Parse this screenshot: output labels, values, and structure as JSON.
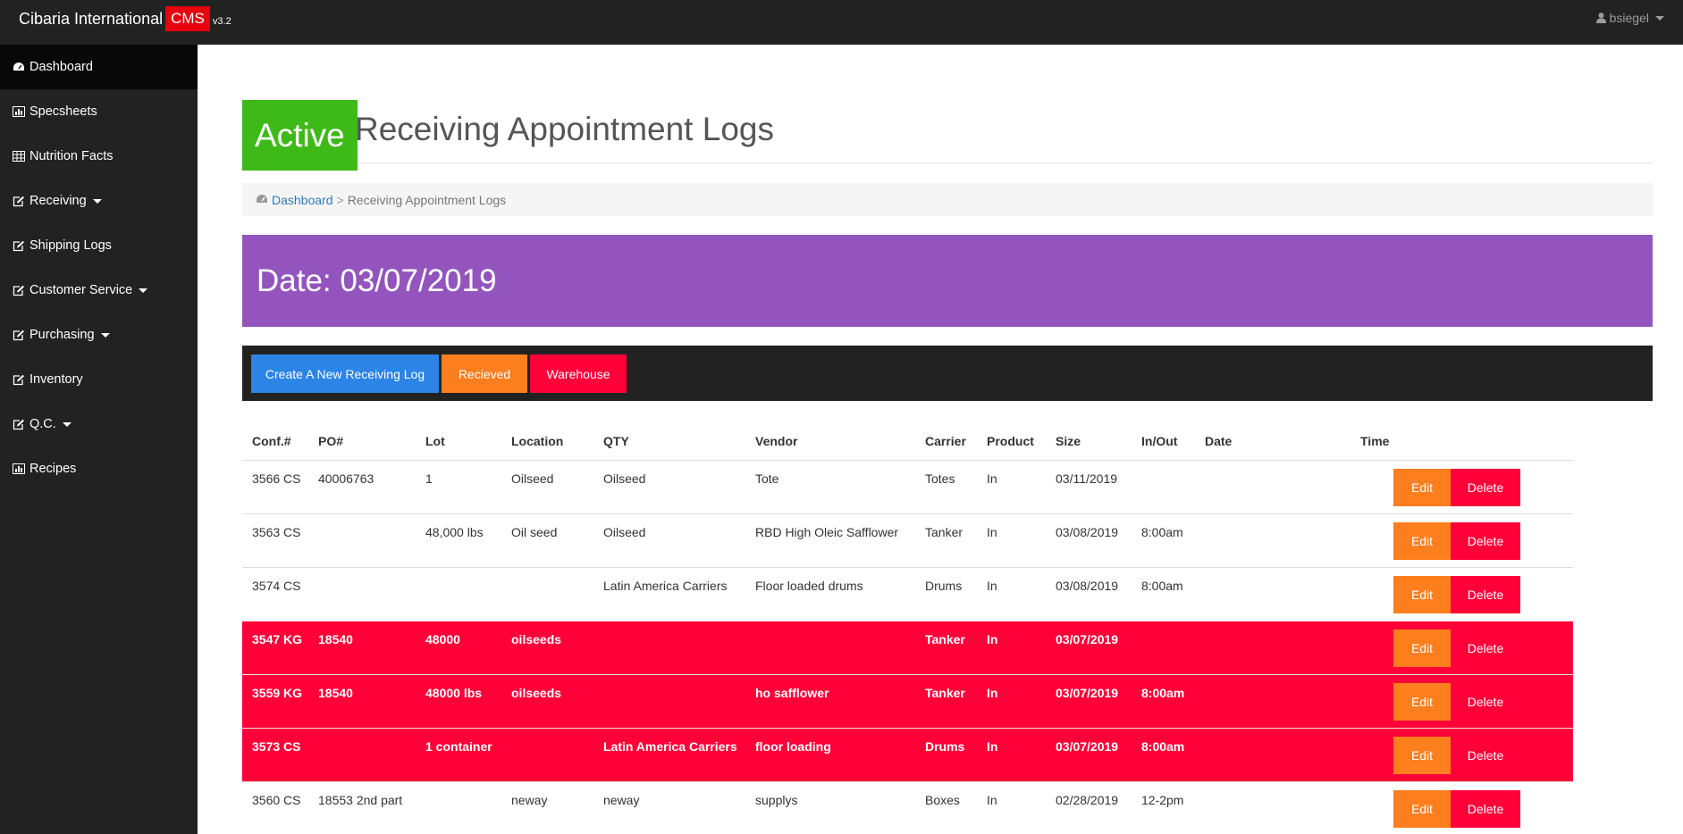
{
  "navbar": {
    "brand_name": "Cibaria International",
    "brand_badge": "CMS",
    "version": "v3.2",
    "username": "bsiegel"
  },
  "sidebar": {
    "items": [
      {
        "label": "Dashboard",
        "icon": "dashboard-icon",
        "dropdown": false
      },
      {
        "label": "Specsheets",
        "icon": "bar-chart-icon",
        "dropdown": false
      },
      {
        "label": "Nutrition Facts",
        "icon": "table-icon",
        "dropdown": false
      },
      {
        "label": "Receiving",
        "icon": "edit-icon",
        "dropdown": true
      },
      {
        "label": "Shipping Logs",
        "icon": "edit-icon",
        "dropdown": false
      },
      {
        "label": "Customer Service",
        "icon": "edit-icon",
        "dropdown": true
      },
      {
        "label": "Purchasing",
        "icon": "edit-icon",
        "dropdown": true
      },
      {
        "label": "Inventory",
        "icon": "edit-icon",
        "dropdown": false
      },
      {
        "label": "Q.C.",
        "icon": "edit-icon",
        "dropdown": true
      },
      {
        "label": "Recipes",
        "icon": "bar-chart-icon",
        "dropdown": false
      }
    ]
  },
  "heading": {
    "badge": "Active",
    "title": "Receiving Appointment Logs"
  },
  "breadcrumb": {
    "home": "Dashboard",
    "separator": ">",
    "current": "Receiving Appointment Logs"
  },
  "date_banner": "Date: 03/07/2019",
  "toolbar": {
    "create_label": "Create A New Receiving Log",
    "received_label": "Recieved",
    "warehouse_label": "Warehouse"
  },
  "table": {
    "headers": [
      "Conf.#",
      "PO#",
      "Lot",
      "Location",
      "QTY",
      "Vendor",
      "Carrier",
      "Product",
      "Size",
      "In/Out",
      "Date",
      "Time"
    ],
    "edit_label": "Edit",
    "delete_label": "Delete",
    "rows": [
      {
        "highlight": false,
        "cells": [
          "3566 CS",
          "40006763",
          "1",
          "Oilseed",
          "Oilseed",
          "Tote",
          "Totes",
          "In",
          "03/11/2019",
          ""
        ]
      },
      {
        "highlight": false,
        "cells": [
          "3563 CS",
          "",
          "48,000 lbs",
          "Oil seed",
          "Oilseed",
          "RBD High Oleic Safflower",
          "Tanker",
          "In",
          "03/08/2019",
          "8:00am"
        ]
      },
      {
        "highlight": false,
        "cells": [
          "3574 CS",
          "",
          "",
          "",
          "Latin America Carriers",
          "Floor loaded drums",
          "Drums",
          "In",
          "03/08/2019",
          "8:00am"
        ]
      },
      {
        "highlight": true,
        "cells": [
          "3547 KG",
          "18540",
          "48000",
          "oilseeds",
          "",
          "",
          "Tanker",
          "In",
          "03/07/2019",
          ""
        ]
      },
      {
        "highlight": true,
        "cells": [
          "3559 KG",
          "18540",
          "48000 lbs",
          "oilseeds",
          "",
          "ho safflower",
          "Tanker",
          "In",
          "03/07/2019",
          "8:00am"
        ]
      },
      {
        "highlight": true,
        "cells": [
          "3573 CS",
          "",
          "1 container",
          "",
          "Latin America Carriers",
          "floor loading",
          "Drums",
          "In",
          "03/07/2019",
          "8:00am"
        ]
      },
      {
        "highlight": false,
        "cells": [
          "3560 CS",
          "18553 2nd part",
          "",
          "neway",
          "neway",
          "supplys",
          "Boxes",
          "In",
          "02/28/2019",
          "12-2pm"
        ]
      }
    ]
  },
  "colors": {
    "navbar_bg": "#222222",
    "active_badge": "#3dba18",
    "date_banner": "#9355bd",
    "create_button": "#2b84e6",
    "received_button": "#ff7e1d",
    "warehouse_button": "#ff0039",
    "highlight_row": "#ff0039",
    "cms_badge": "#e8000e"
  }
}
